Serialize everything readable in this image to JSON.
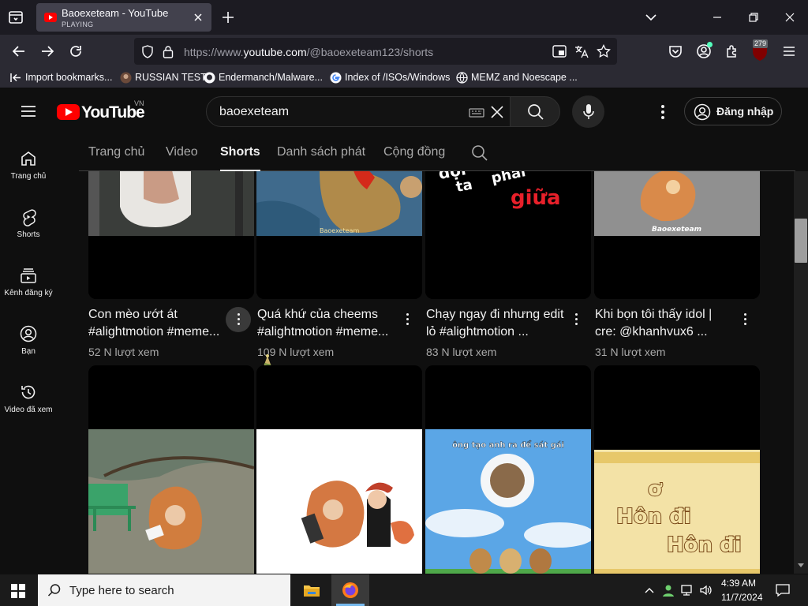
{
  "browser": {
    "tab": {
      "title": "Baoexeteam - YouTube",
      "status": "PLAYING"
    },
    "url": {
      "prefix": "https://www.",
      "domain": "youtube.com",
      "path": "/@baoexeteam123/shorts"
    },
    "notification_badge": "279",
    "bookmarks": [
      {
        "label": "Import bookmarks...",
        "icon": "import-icon"
      },
      {
        "label": "RUSSIAN TEST",
        "icon": "avatar-icon"
      },
      {
        "label": "Endermanch/Malware...",
        "icon": "github-icon"
      },
      {
        "label": "Index of /ISOs/Windows",
        "icon": "google-icon"
      },
      {
        "label": "MEMZ and Noescape ...",
        "icon": "globe-icon"
      }
    ]
  },
  "youtube": {
    "logo_text": "YouTube",
    "region": "VN",
    "search": {
      "value": "baoexeteam"
    },
    "signin_label": "Đăng nhập",
    "sidebar": [
      {
        "label": "Trang chủ",
        "icon": "home-icon"
      },
      {
        "label": "Shorts",
        "icon": "shorts-icon"
      },
      {
        "label": "Kênh đăng ký",
        "icon": "subscriptions-icon"
      },
      {
        "label": "Bạn",
        "icon": "you-icon"
      },
      {
        "label": "Video đã xem",
        "icon": "history-icon"
      }
    ],
    "channel_tabs": [
      {
        "label": "Trang chủ",
        "active": false
      },
      {
        "label": "Video",
        "active": false
      },
      {
        "label": "Shorts",
        "active": true
      },
      {
        "label": "Danh sách phát",
        "active": false
      },
      {
        "label": "Cộng đồng",
        "active": false
      }
    ],
    "videos_row1": [
      {
        "title_line1": "Con mèo ướt át",
        "title_line2": "#alightmotion #meme...",
        "views": "52 N lượt xem"
      },
      {
        "title_line1": "Quá khứ của cheems",
        "title_line2": "#alightmotion #meme...",
        "views": "109 N lượt xem"
      },
      {
        "title_line1": "Chạy ngay đi nhưng edit",
        "title_line2": "lỏ #alightmotion ...",
        "views": "83 N lượt xem"
      },
      {
        "title_line1": "Khi bọn tôi thấy idol |",
        "title_line2": "cre: @khanhvux6 ...",
        "views": "31 N lượt xem"
      }
    ],
    "thumb_texts": {
      "watermark_a": "Baoexeteam",
      "watermark_b": "Baoexeteam",
      "caption_c": "ông tạo anh ra để sát gái",
      "caption_d1": "ơ",
      "caption_d2": "Hôn đi",
      "caption_d3": "Hôn đi",
      "lyric_1": "đợi",
      "lyric_2": "ta",
      "lyric_3": "phai",
      "lyric_4": "giữa"
    }
  },
  "taskbar": {
    "search_placeholder": "Type here to search",
    "time": "4:39 AM",
    "date": "11/7/2024"
  }
}
